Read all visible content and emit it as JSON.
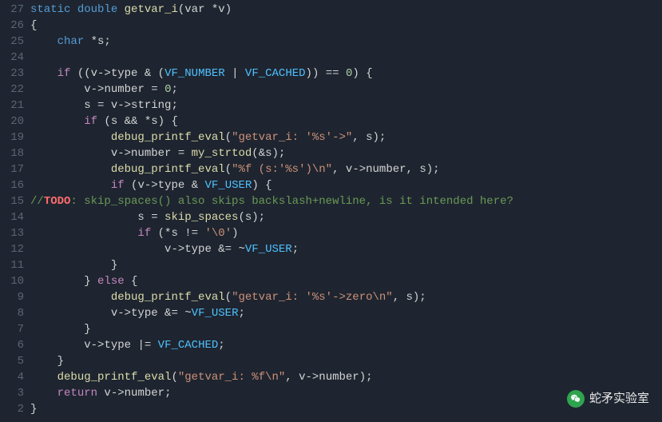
{
  "lines": [
    {
      "num": "27",
      "tokens": [
        {
          "t": "static",
          "c": "kw"
        },
        {
          "t": " "
        },
        {
          "t": "double",
          "c": "type"
        },
        {
          "t": " "
        },
        {
          "t": "getvar_i",
          "c": "fn"
        },
        {
          "t": "(var "
        },
        {
          "t": "*",
          "c": "op"
        },
        {
          "t": "v)"
        }
      ]
    },
    {
      "num": "26",
      "tokens": [
        {
          "t": "{",
          "c": "punct"
        }
      ]
    },
    {
      "num": "25",
      "tokens": [
        {
          "t": "    "
        },
        {
          "t": "char",
          "c": "type"
        },
        {
          "t": " "
        },
        {
          "t": "*",
          "c": "op"
        },
        {
          "t": "s;"
        }
      ]
    },
    {
      "num": "24",
      "tokens": []
    },
    {
      "num": "23",
      "tokens": [
        {
          "t": "    "
        },
        {
          "t": "if",
          "c": "kw2"
        },
        {
          "t": " ((v"
        },
        {
          "t": "->",
          "c": "op"
        },
        {
          "t": "type "
        },
        {
          "t": "&",
          "c": "op"
        },
        {
          "t": " ("
        },
        {
          "t": "VF_NUMBER",
          "c": "const"
        },
        {
          "t": " "
        },
        {
          "t": "|",
          "c": "op"
        },
        {
          "t": " "
        },
        {
          "t": "VF_CACHED",
          "c": "const"
        },
        {
          "t": ")) "
        },
        {
          "t": "==",
          "c": "op"
        },
        {
          "t": " "
        },
        {
          "t": "0",
          "c": "num"
        },
        {
          "t": ") {"
        }
      ]
    },
    {
      "num": "22",
      "tokens": [
        {
          "t": "        v"
        },
        {
          "t": "->",
          "c": "op"
        },
        {
          "t": "number "
        },
        {
          "t": "=",
          "c": "op"
        },
        {
          "t": " "
        },
        {
          "t": "0",
          "c": "num"
        },
        {
          "t": ";"
        }
      ]
    },
    {
      "num": "21",
      "tokens": [
        {
          "t": "        s "
        },
        {
          "t": "=",
          "c": "op"
        },
        {
          "t": " v"
        },
        {
          "t": "->",
          "c": "op"
        },
        {
          "t": "string;"
        }
      ]
    },
    {
      "num": "20",
      "tokens": [
        {
          "t": "        "
        },
        {
          "t": "if",
          "c": "kw2"
        },
        {
          "t": " (s "
        },
        {
          "t": "&&",
          "c": "op"
        },
        {
          "t": " "
        },
        {
          "t": "*",
          "c": "op"
        },
        {
          "t": "s) {"
        }
      ]
    },
    {
      "num": "19",
      "tokens": [
        {
          "t": "            "
        },
        {
          "t": "debug_printf_eval",
          "c": "fn"
        },
        {
          "t": "("
        },
        {
          "t": "\"getvar_i: '%s'->\"",
          "c": "str"
        },
        {
          "t": ", s);"
        }
      ]
    },
    {
      "num": "18",
      "tokens": [
        {
          "t": "            v"
        },
        {
          "t": "->",
          "c": "op"
        },
        {
          "t": "number "
        },
        {
          "t": "=",
          "c": "op"
        },
        {
          "t": " "
        },
        {
          "t": "my_strtod",
          "c": "fn"
        },
        {
          "t": "("
        },
        {
          "t": "&",
          "c": "op"
        },
        {
          "t": "s);"
        }
      ]
    },
    {
      "num": "17",
      "tokens": [
        {
          "t": "            "
        },
        {
          "t": "debug_printf_eval",
          "c": "fn"
        },
        {
          "t": "("
        },
        {
          "t": "\"%f (s:'%s')\\n\"",
          "c": "str"
        },
        {
          "t": ", v"
        },
        {
          "t": "->",
          "c": "op"
        },
        {
          "t": "number, s);"
        }
      ]
    },
    {
      "num": "16",
      "tokens": [
        {
          "t": "            "
        },
        {
          "t": "if",
          "c": "kw2"
        },
        {
          "t": " (v"
        },
        {
          "t": "->",
          "c": "op"
        },
        {
          "t": "type "
        },
        {
          "t": "&",
          "c": "op"
        },
        {
          "t": " "
        },
        {
          "t": "VF_USER",
          "c": "const"
        },
        {
          "t": ") {"
        }
      ]
    },
    {
      "num": "15",
      "tokens": [
        {
          "t": "//",
          "c": "comment"
        },
        {
          "t": "TODO",
          "c": "todo"
        },
        {
          "t": ": skip_spaces() also skips backslash+newline, is it intended here?",
          "c": "comment"
        }
      ]
    },
    {
      "num": "14",
      "tokens": [
        {
          "t": "                s "
        },
        {
          "t": "=",
          "c": "op"
        },
        {
          "t": " "
        },
        {
          "t": "skip_spaces",
          "c": "fn"
        },
        {
          "t": "(s);"
        }
      ]
    },
    {
      "num": "13",
      "tokens": [
        {
          "t": "                "
        },
        {
          "t": "if",
          "c": "kw2"
        },
        {
          "t": " ("
        },
        {
          "t": "*",
          "c": "op"
        },
        {
          "t": "s "
        },
        {
          "t": "!=",
          "c": "op"
        },
        {
          "t": " "
        },
        {
          "t": "'\\0'",
          "c": "str"
        },
        {
          "t": ")"
        }
      ]
    },
    {
      "num": "12",
      "tokens": [
        {
          "t": "                    v"
        },
        {
          "t": "->",
          "c": "op"
        },
        {
          "t": "type "
        },
        {
          "t": "&=",
          "c": "op"
        },
        {
          "t": " "
        },
        {
          "t": "~",
          "c": "op"
        },
        {
          "t": "VF_USER",
          "c": "const"
        },
        {
          "t": ";"
        }
      ]
    },
    {
      "num": "11",
      "tokens": [
        {
          "t": "            }"
        }
      ]
    },
    {
      "num": "10",
      "tokens": [
        {
          "t": "        } "
        },
        {
          "t": "else",
          "c": "kw2"
        },
        {
          "t": " {"
        }
      ]
    },
    {
      "num": "9",
      "tokens": [
        {
          "t": "            "
        },
        {
          "t": "debug_printf_eval",
          "c": "fn"
        },
        {
          "t": "("
        },
        {
          "t": "\"getvar_i: '%s'->zero\\n\"",
          "c": "str"
        },
        {
          "t": ", s);"
        }
      ]
    },
    {
      "num": "8",
      "tokens": [
        {
          "t": "            v"
        },
        {
          "t": "->",
          "c": "op"
        },
        {
          "t": "type "
        },
        {
          "t": "&=",
          "c": "op"
        },
        {
          "t": " "
        },
        {
          "t": "~",
          "c": "op"
        },
        {
          "t": "VF_USER",
          "c": "const"
        },
        {
          "t": ";"
        }
      ]
    },
    {
      "num": "7",
      "tokens": [
        {
          "t": "        }"
        }
      ]
    },
    {
      "num": "6",
      "tokens": [
        {
          "t": "        v"
        },
        {
          "t": "->",
          "c": "op"
        },
        {
          "t": "type "
        },
        {
          "t": "|=",
          "c": "op"
        },
        {
          "t": " "
        },
        {
          "t": "VF_CACHED",
          "c": "const"
        },
        {
          "t": ";"
        }
      ]
    },
    {
      "num": "5",
      "tokens": [
        {
          "t": "    }"
        }
      ]
    },
    {
      "num": "4",
      "tokens": [
        {
          "t": "    "
        },
        {
          "t": "debug_printf_eval",
          "c": "fn"
        },
        {
          "t": "("
        },
        {
          "t": "\"getvar_i: %f\\n\"",
          "c": "str"
        },
        {
          "t": ", v"
        },
        {
          "t": "->",
          "c": "op"
        },
        {
          "t": "number);"
        }
      ]
    },
    {
      "num": "3",
      "tokens": [
        {
          "t": "    "
        },
        {
          "t": "return",
          "c": "kw2"
        },
        {
          "t": " v"
        },
        {
          "t": "->",
          "c": "op"
        },
        {
          "t": "number;"
        }
      ]
    },
    {
      "num": "2",
      "tokens": [
        {
          "t": "}"
        }
      ]
    }
  ],
  "watermark": {
    "text": "蛇矛实验室"
  }
}
